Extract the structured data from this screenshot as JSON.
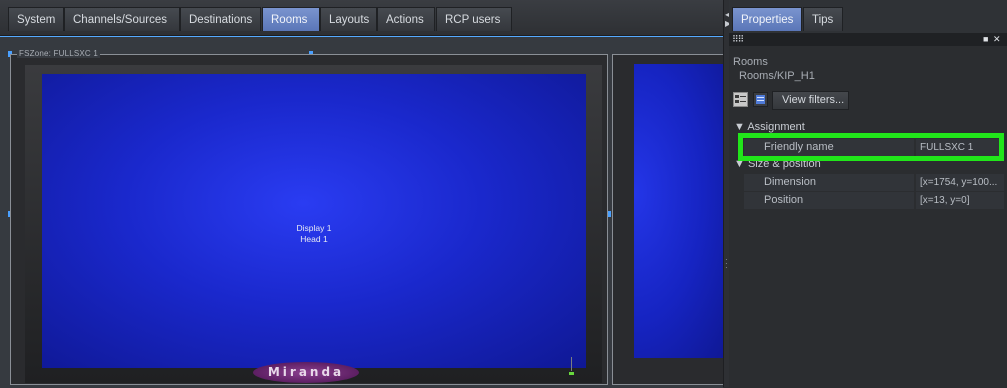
{
  "tabs": [
    {
      "label": "System"
    },
    {
      "label": "Channels/Sources"
    },
    {
      "label": "Destinations"
    },
    {
      "label": "Rooms",
      "active": true
    },
    {
      "label": "Layouts"
    },
    {
      "label": "Actions"
    },
    {
      "label": "RCP users"
    }
  ],
  "canvas": {
    "zone_label": "FSZone: FULLSXC 1",
    "display_line1": "Display 1",
    "display_line2": "Head 1",
    "logo_text": "Miranda"
  },
  "panel": {
    "tabs": [
      {
        "label": "Properties",
        "active": true
      },
      {
        "label": "Tips"
      }
    ],
    "path_label": "Rooms",
    "path_value": "Rooms/KIP_H1",
    "view_filters_label": "View filters...",
    "assignment_section": "Assignment",
    "size_section": "Size & position",
    "rows": [
      {
        "label": "Friendly name",
        "value": "FULLSXC 1"
      },
      {
        "label": "Dimension",
        "value": "[x=1754, y=100..."
      },
      {
        "label": "Position",
        "value": "[x=13, y=0]"
      }
    ]
  },
  "colors": {
    "accent_tab": "#6a85c4",
    "screen_blue": "#1a28cc",
    "highlight_green": "#21e61a"
  }
}
